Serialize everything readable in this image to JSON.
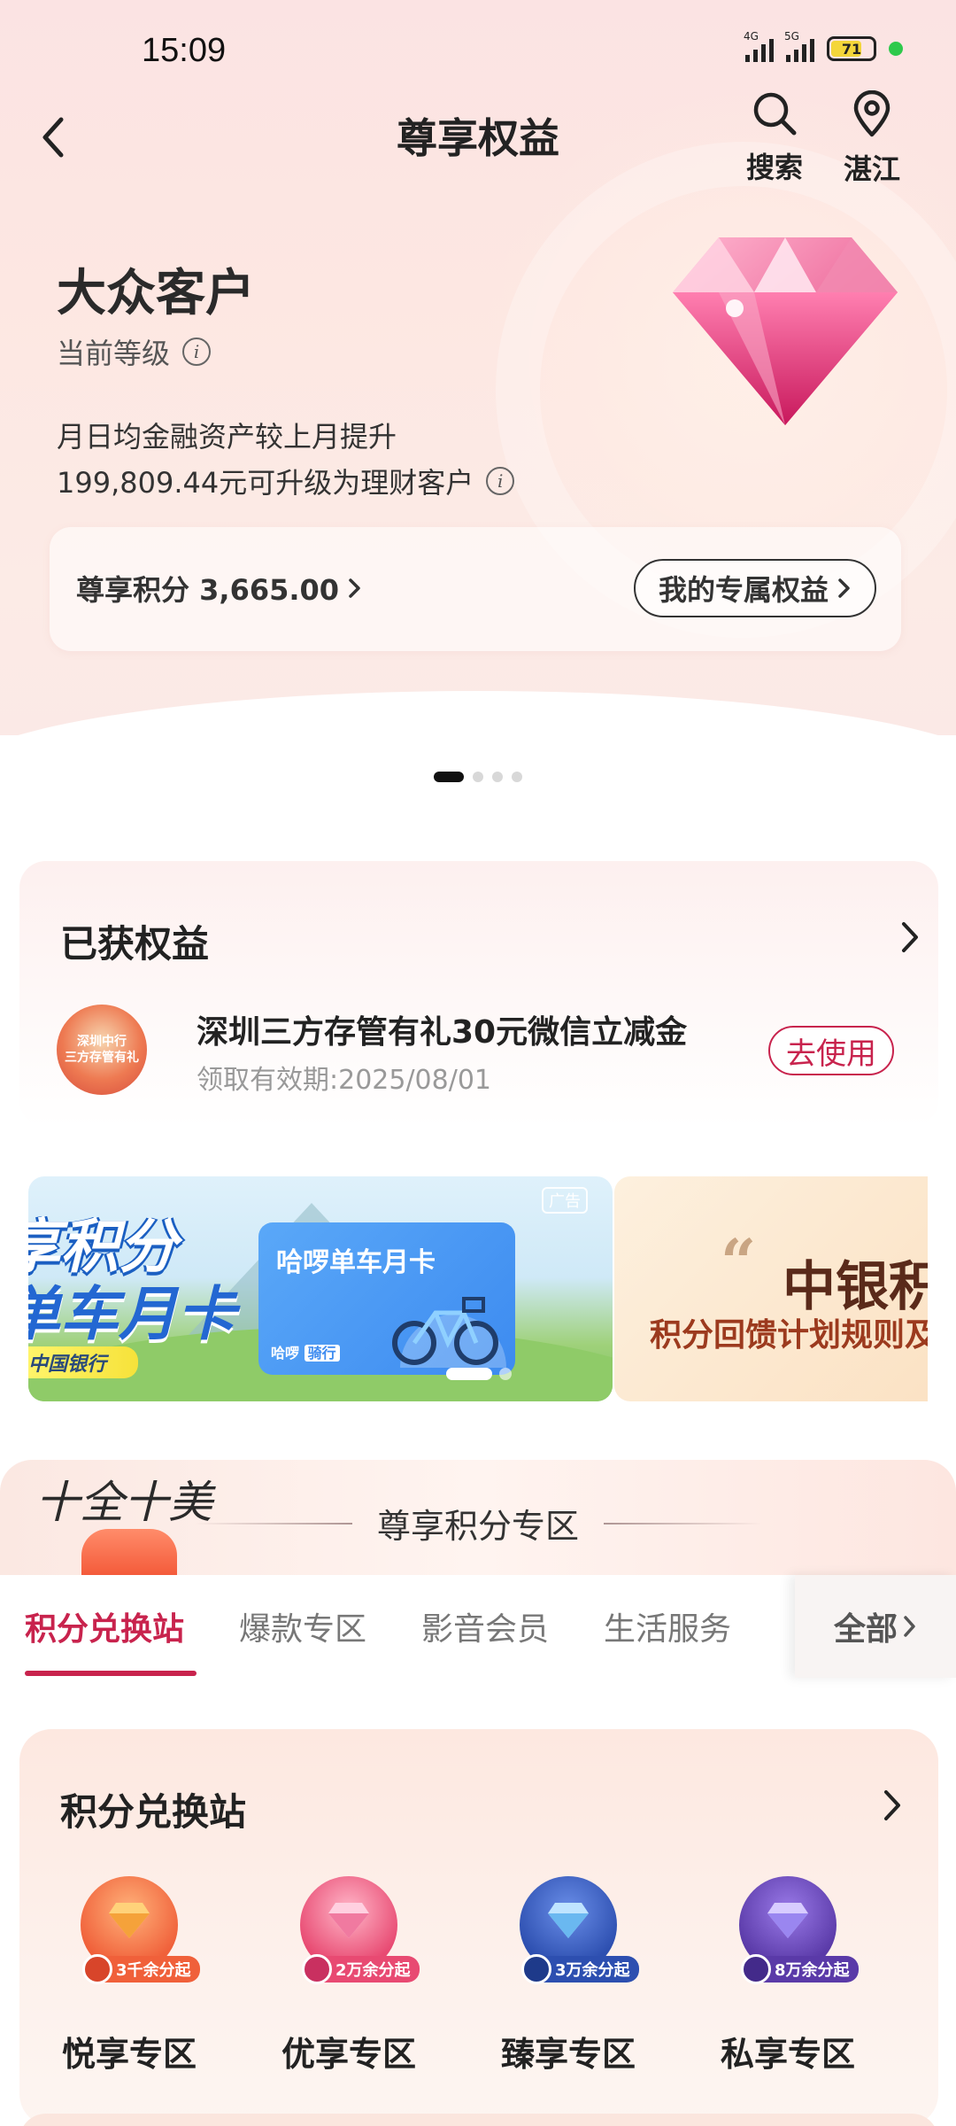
{
  "status_bar": {
    "time": "15:09",
    "net1": "4G",
    "net2": "5G",
    "battery": "71"
  },
  "nav": {
    "title": "尊享权益",
    "search_label": "搜索",
    "location_label": "湛江"
  },
  "hero": {
    "level_name": "大众客户",
    "level_caption": "当前等级",
    "upgrade_line1": "月日均金融资产较上月提升",
    "upgrade_line2": "199,809.44元可升级为理财客户",
    "points_label": "尊享积分 3,665.00",
    "my_rights_button": "我的专属权益"
  },
  "obtained": {
    "title": "已获权益",
    "icon_text1": "深圳中行",
    "icon_text2": "三方存管有礼",
    "item_title": "深圳三方存管有礼30元微信立减金",
    "item_date": "领取有效期:2025/08/01",
    "use_button": "去使用"
  },
  "banners": {
    "ad_promo_1": "享积分",
    "ad_promo_2": "单车月卡",
    "ad_promo_3": "中国银行",
    "ad_tag": "广告",
    "ad_card_title": "哈啰单车月卡",
    "ad_card_brand": "哈啰",
    "ad_card_brand2": "骑行",
    "boc_title": "中银积分",
    "boc_subtitle": "积分回馈计划规则及"
  },
  "points_zone": {
    "logo": "十全十美",
    "title": "尊享积分专区",
    "tabs": [
      "积分兑换站",
      "爆款专区",
      "影音会员",
      "生活服务"
    ],
    "all_label": "全部"
  },
  "exchange": {
    "title": "积分兑换站",
    "items": [
      {
        "label": "悦享专区",
        "badge": "3千余分起",
        "color": "#f0603a"
      },
      {
        "label": "优享专区",
        "badge": "2万余分起",
        "color": "#e84a72"
      },
      {
        "label": "臻享专区",
        "badge": "3万余分起",
        "color": "#2d4fb0"
      },
      {
        "label": "私享专区",
        "badge": "8万余分起",
        "color": "#5a3aa8"
      }
    ]
  },
  "colors": {
    "accent": "#c8234d",
    "hero_bg": "#fbe3e3"
  }
}
